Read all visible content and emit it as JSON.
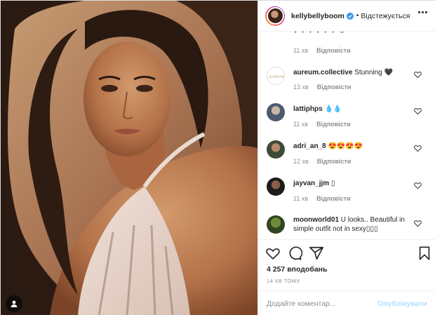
{
  "post": {
    "author": "kellybellyboom",
    "verified": true,
    "separator": "•",
    "follow_state": "Відстежується"
  },
  "comments": {
    "truncated_text": "♥ ♥ ♥ ♥ ♥ ♥ ☺",
    "first_meta": {
      "time": "11 хв",
      "reply": "Відповісти"
    },
    "items": [
      {
        "user": "aureum.collective",
        "text": "Stunning 🖤",
        "time": "13 хв",
        "reply": "Відповісти",
        "avatar": "aureum-logo"
      },
      {
        "user": "lattiphps",
        "text": "💧💧",
        "time": "11 хв",
        "reply": "Відповісти",
        "avatar": "user-photo"
      },
      {
        "user": "adri_an_8",
        "text": "😍😍😍😍",
        "time": "12 хв",
        "reply": "Відповісти",
        "avatar": "user-photo"
      },
      {
        "user": "jayvan_jjm",
        "text": "▯",
        "time": "11 хв",
        "reply": "Відповісти",
        "avatar": "user-photo"
      },
      {
        "user": "moonworld01",
        "text": "U looks.. Beautiful in simple outfit not in sexy▯▯▯",
        "time": "",
        "reply": "",
        "avatar": "user-photo"
      }
    ]
  },
  "actions": {
    "icons": [
      "heart-icon",
      "comment-icon",
      "share-icon",
      "bookmark-icon"
    ]
  },
  "likes": "4 257 вподобань",
  "timestamp": "14 хв тому",
  "composer": {
    "placeholder": "Додайте коментар...",
    "post_label": "Опублікувати"
  },
  "colors": {
    "accent": "#0095f6",
    "accent_disabled": "#b2dffc",
    "verified": "#3897f0",
    "muted_text": "#8e8e8e",
    "border": "#efefef"
  }
}
